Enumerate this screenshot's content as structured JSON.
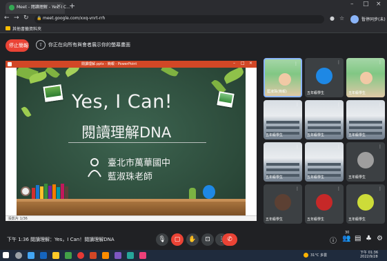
{
  "browser": {
    "tab_title": "Meet - 閱讀理解 - Yes, I C...",
    "tab_close": "×",
    "new_tab": "+",
    "url": "meet.google.com/xxq-vnrt-rrh",
    "profile_name": "暫停同步(未)",
    "bookmark": "其他書籤資料夾",
    "window_minimize": "–",
    "window_maximize": "□",
    "window_close": "×"
  },
  "presenting": {
    "stop_label": "停止簡報",
    "message": "你正在向所有與會者展示你的螢幕畫面"
  },
  "shared_window": {
    "title": "閱讀理解.pptx - 簡報 - PowerPoint",
    "status_text": "投影片 1/36"
  },
  "slide": {
    "title": "Yes,  I Can!",
    "subtitle": "閱讀理解DNA",
    "school": "臺北市萬華國中",
    "teacher": "藍淑珠老師"
  },
  "participants": [
    {
      "name": "藍淑珠(簡報)",
      "type": "video-person"
    },
    {
      "name": "五年級學生",
      "type": "avatar",
      "color": "#1e88e5"
    },
    {
      "name": "五年級學生",
      "type": "video-person"
    },
    {
      "name": "五年級學生",
      "type": "classroom"
    },
    {
      "name": "五年級學生",
      "type": "classroom"
    },
    {
      "name": "五年級學生",
      "type": "classroom"
    },
    {
      "name": "五年級學生",
      "type": "classroom"
    },
    {
      "name": "五年級學生",
      "type": "classroom"
    },
    {
      "name": "五年級學生",
      "type": "avatar",
      "color": "#9e9e9e"
    },
    {
      "name": "五年級學生",
      "type": "avatar",
      "color": "#5c4033"
    },
    {
      "name": "五年級學生",
      "type": "avatar",
      "color": "#c62828"
    },
    {
      "name": "五年級學生",
      "type": "avatar",
      "color": "#cddc39"
    }
  ],
  "bottom": {
    "time": "下午 1:36",
    "meeting_title": "閱讀理解：Yes，I Can！閱讀理解DNA",
    "people_count": "30"
  },
  "taskbar": {
    "weather": "31°C 多雲",
    "clock_time": "下午 01:36",
    "clock_date": "2022/9/28"
  }
}
